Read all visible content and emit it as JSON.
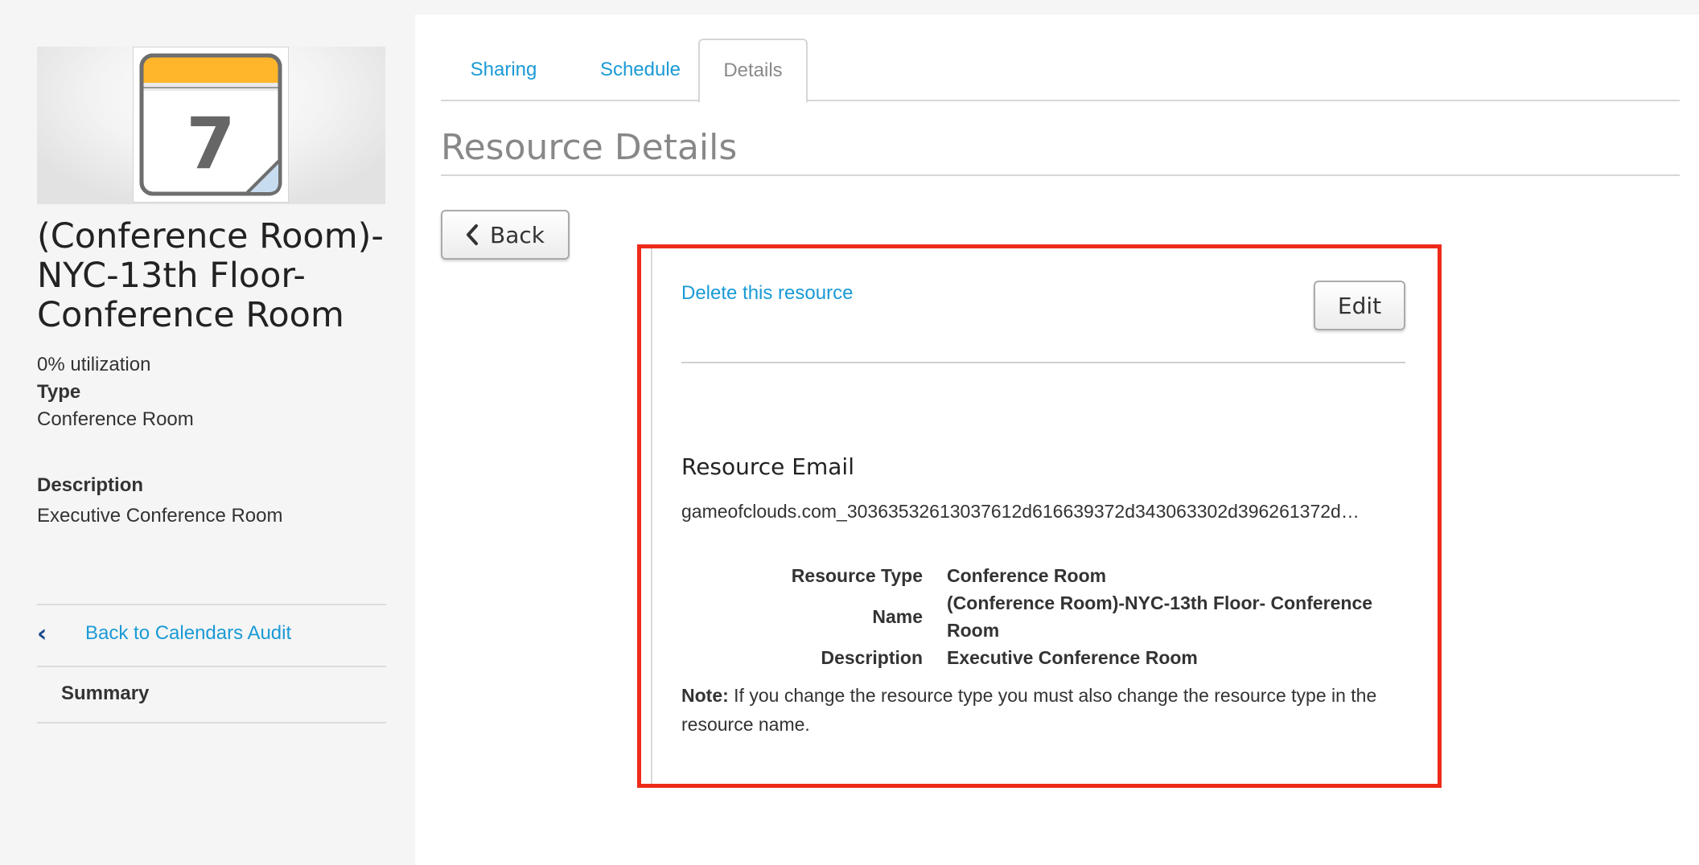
{
  "sidebar": {
    "calendar_icon_day": "7",
    "resource_name": "(Conference Room)-NYC-13th Floor-Conference Room",
    "utilization": "0% utilization",
    "type_label": "Type",
    "type_value": "Conference Room",
    "description_label": "Description",
    "description_value": "Executive Conference Room",
    "back_link_label": "Back to Calendars Audit",
    "summary_label": "Summary"
  },
  "tabs": [
    {
      "label": "Sharing",
      "active": false
    },
    {
      "label": "Schedule",
      "active": false
    },
    {
      "label": "Details",
      "active": true
    }
  ],
  "page_title": "Resource Details",
  "back_button_label": "Back",
  "panel": {
    "delete_link": "Delete this resource",
    "edit_button": "Edit",
    "email_heading": "Resource Email",
    "email_value": "gameofclouds.com_30363532613037612d616639372d343063302d396261372d…",
    "fields": [
      {
        "label": "Resource Type",
        "value": "Conference Room"
      },
      {
        "label": "Name",
        "value": "(Conference Room)-NYC-13th Floor- Conference Room"
      },
      {
        "label": "Description",
        "value": "Executive Conference Room"
      }
    ],
    "note_label": "Note:",
    "note_text": " If you change the resource type you must also change the resource type in the resource name."
  },
  "colors": {
    "link": "#1a9ad6",
    "highlight_border": "#ee2a1a",
    "calendar_header": "#ffb62a"
  },
  "icons": [
    "calendar-icon",
    "chevron-left-icon"
  ]
}
